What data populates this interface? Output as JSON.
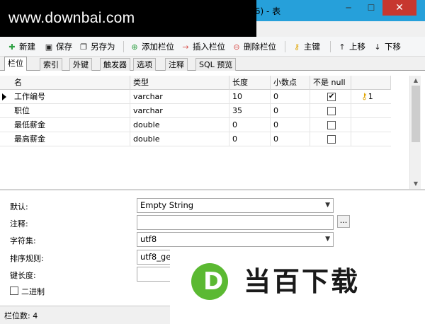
{
  "window": {
    "title_suffix": ".6) - 表",
    "minimize_glyph": "─",
    "maximize_glyph": "☐",
    "close_glyph": "✕"
  },
  "watermark": {
    "text": "www.downbai.com"
  },
  "toolbar": {
    "items": [
      {
        "label": "新建",
        "icon": "new-icon",
        "glyph": "✚",
        "color": "#2ea043"
      },
      {
        "label": "保存",
        "icon": "save-icon",
        "glyph": "▣",
        "color": "#222222"
      },
      {
        "label": "另存为",
        "icon": "save-as-icon",
        "glyph": "❐",
        "color": "#222222"
      },
      {
        "label": "添加栏位",
        "icon": "add-column-icon",
        "glyph": "⊕",
        "color": "#2ea043"
      },
      {
        "label": "插入栏位",
        "icon": "insert-column-icon",
        "glyph": "→",
        "color": "#d9534f"
      },
      {
        "label": "删除栏位",
        "icon": "delete-column-icon",
        "glyph": "⊖",
        "color": "#d9534f"
      },
      {
        "label": "主键",
        "icon": "key-icon",
        "glyph": "⚷",
        "color": "#e0a400"
      },
      {
        "label": "上移",
        "icon": "arrow-up-icon",
        "glyph": "↑",
        "color": "#222222"
      },
      {
        "label": "下移",
        "icon": "arrow-down-icon",
        "glyph": "↓",
        "color": "#222222"
      }
    ]
  },
  "tabs": [
    {
      "label": "栏位",
      "active": true
    },
    {
      "label": "索引",
      "active": false
    },
    {
      "label": "外键",
      "active": false
    },
    {
      "label": "触发器",
      "active": false
    },
    {
      "label": "选项",
      "active": false
    },
    {
      "label": "注释",
      "active": false
    },
    {
      "label": "SQL 预览",
      "active": false
    }
  ],
  "grid": {
    "headers": [
      "名",
      "类型",
      "长度",
      "小数点",
      "不是 null",
      ""
    ],
    "rows": [
      {
        "name": "工作编号",
        "type": "varchar",
        "length": "10",
        "decimals": "0",
        "not_null": true,
        "key": "1",
        "current": true
      },
      {
        "name": "职位",
        "type": "varchar",
        "length": "35",
        "decimals": "0",
        "not_null": false,
        "key": "",
        "current": false
      },
      {
        "name": "最低薪金",
        "type": "double",
        "length": "0",
        "decimals": "0",
        "not_null": false,
        "key": "",
        "current": false
      },
      {
        "name": "最高薪金",
        "type": "double",
        "length": "0",
        "decimals": "0",
        "not_null": false,
        "key": "",
        "current": false
      }
    ]
  },
  "props": {
    "default_label": "默认:",
    "default_value": "Empty String",
    "comment_label": "注释:",
    "comment_value": "",
    "ellipsis": "...",
    "charset_label": "字符集:",
    "charset_value": "utf8",
    "collation_label": "排序规则:",
    "collation_value": "utf8_ge",
    "keylen_label": "键长度:",
    "keylen_value": "",
    "binary_label": "二进制"
  },
  "status": {
    "text": "栏位数: 4"
  },
  "logo": {
    "letter": "D",
    "text": "当百下载"
  },
  "colors": {
    "titlebar": "#26a0da",
    "close": "#c7372f",
    "logo_green": "#5bb932"
  }
}
